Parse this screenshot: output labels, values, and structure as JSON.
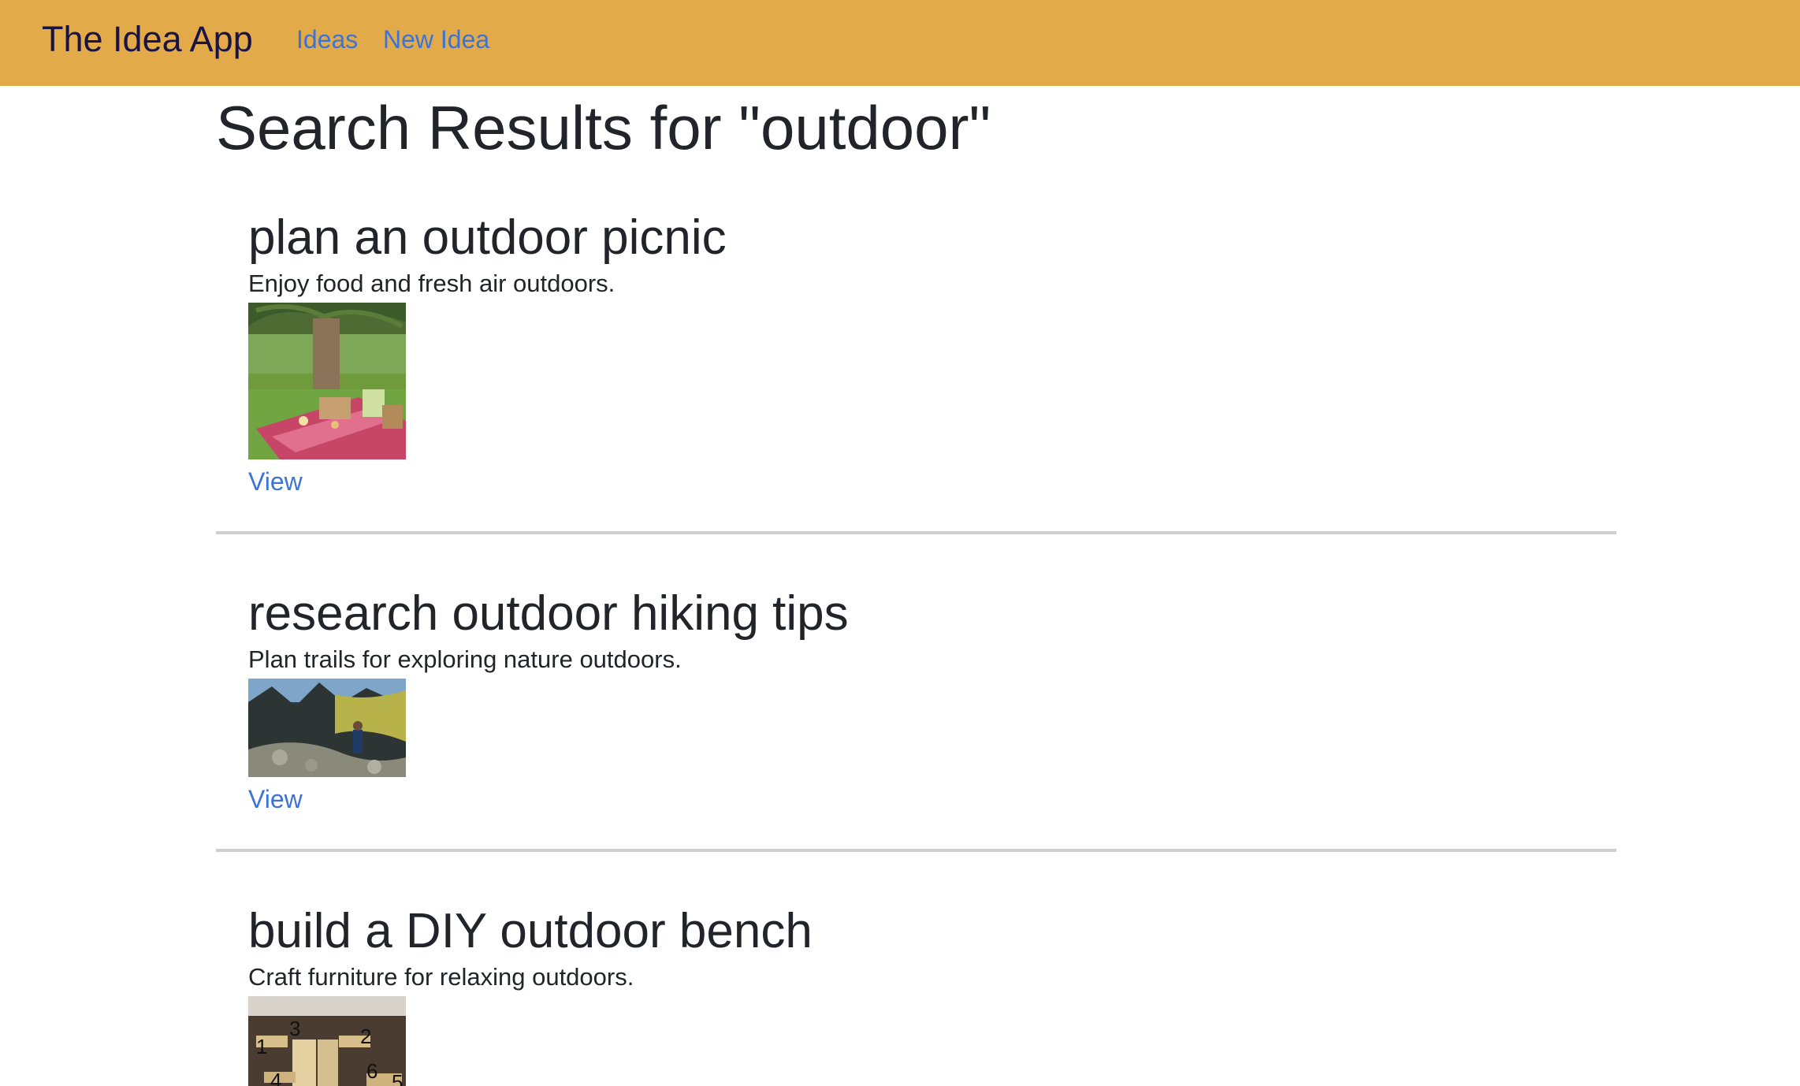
{
  "navbar": {
    "brand": "The Idea App",
    "links": [
      "Ideas",
      "New Idea"
    ],
    "background_color": "#e2aa48",
    "link_color": "#3b73d6"
  },
  "page": {
    "title": "Search Results for \"outdoor\""
  },
  "results": [
    {
      "title": "plan an outdoor picnic",
      "description": "Enjoy food and fresh air outdoors.",
      "image_icon": "picnic-photo",
      "link_label": "View"
    },
    {
      "title": "research outdoor hiking tips",
      "description": "Plan trails for exploring nature outdoors.",
      "image_icon": "hiking-photo",
      "link_label": "View"
    },
    {
      "title": "build a DIY outdoor bench",
      "description": "Craft furniture for relaxing outdoors.",
      "image_icon": "bench-diagram-photo",
      "image_labels": [
        "1",
        "3",
        "2",
        "4",
        "6",
        "5"
      ]
    }
  ]
}
